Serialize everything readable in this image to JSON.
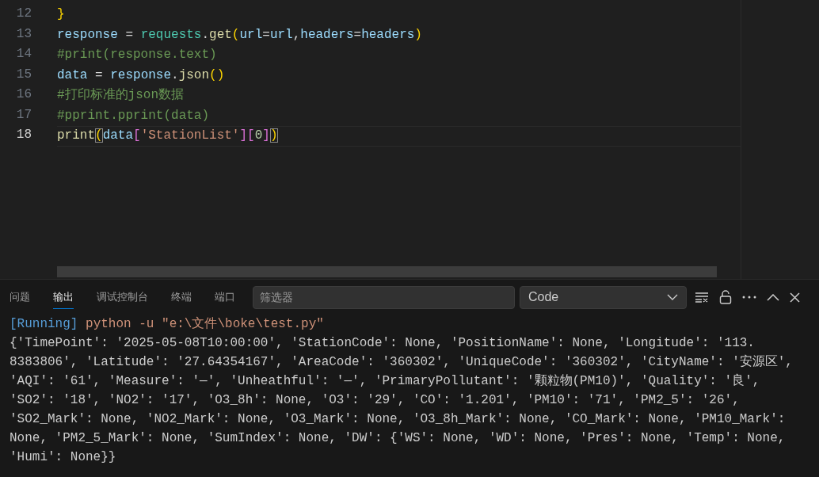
{
  "editor": {
    "lines": [
      {
        "number": "12",
        "current": false,
        "tokens": [
          {
            "kind": "bracket",
            "text": "}"
          }
        ]
      },
      {
        "number": "13",
        "current": false,
        "tokens": [
          {
            "kind": "variable",
            "text": "response"
          },
          {
            "kind": "operator",
            "text": " = "
          },
          {
            "kind": "module",
            "text": "requests"
          },
          {
            "kind": "operator",
            "text": "."
          },
          {
            "kind": "function",
            "text": "get"
          },
          {
            "kind": "bracket",
            "text": "("
          },
          {
            "kind": "variable",
            "text": "url"
          },
          {
            "kind": "operator",
            "text": "="
          },
          {
            "kind": "variable",
            "text": "url"
          },
          {
            "kind": "operator",
            "text": ","
          },
          {
            "kind": "variable",
            "text": "headers"
          },
          {
            "kind": "operator",
            "text": "="
          },
          {
            "kind": "variable",
            "text": "headers"
          },
          {
            "kind": "bracket",
            "text": ")"
          }
        ]
      },
      {
        "number": "14",
        "current": false,
        "tokens": [
          {
            "kind": "comment",
            "text": "#print(response.text)"
          }
        ]
      },
      {
        "number": "15",
        "current": false,
        "tokens": [
          {
            "kind": "variable",
            "text": "data"
          },
          {
            "kind": "operator",
            "text": " = "
          },
          {
            "kind": "variable",
            "text": "response"
          },
          {
            "kind": "operator",
            "text": "."
          },
          {
            "kind": "function",
            "text": "json"
          },
          {
            "kind": "bracket",
            "text": "()"
          }
        ]
      },
      {
        "number": "16",
        "current": false,
        "tokens": [
          {
            "kind": "comment",
            "text": "#打印标准的json数据"
          }
        ]
      },
      {
        "number": "17",
        "current": false,
        "tokens": [
          {
            "kind": "comment",
            "text": "#pprint.pprint(data)"
          }
        ]
      },
      {
        "number": "18",
        "current": true,
        "tokens": [
          {
            "kind": "function",
            "text": "print"
          },
          {
            "kind": "bracket",
            "text": "(",
            "matched": true
          },
          {
            "kind": "variable",
            "text": "data"
          },
          {
            "kind": "bracket2",
            "text": "["
          },
          {
            "kind": "string",
            "text": "'StationList'"
          },
          {
            "kind": "bracket2",
            "text": "]["
          },
          {
            "kind": "number",
            "text": "0"
          },
          {
            "kind": "bracket2",
            "text": "]"
          },
          {
            "kind": "bracket",
            "text": ")",
            "matched": true
          }
        ]
      }
    ]
  },
  "panel": {
    "tabs": [
      {
        "label": "问题",
        "selected": false
      },
      {
        "label": "输出",
        "selected": true
      },
      {
        "label": "调试控制台",
        "selected": false
      },
      {
        "label": "终端",
        "selected": false
      },
      {
        "label": "端口",
        "selected": false
      }
    ],
    "filter": {
      "placeholder": "筛选器"
    },
    "channel": {
      "value": "Code"
    },
    "output": {
      "status": "[Running]",
      "command": "python -u \"e:\\文件\\boke\\test.py\"",
      "lines": [
        "{'TimePoint': '2025-05-08T10:00:00', 'StationCode': None, 'PositionName': None, 'Longitude': '113.",
        "8383806', 'Latitude': '27.64354167', 'AreaCode': '360302', 'UniqueCode': '360302', 'CityName': '安源区',",
        "'AQI': '61', 'Measure': '—', 'Unheathful': '—', 'PrimaryPollutant': '颗粒物(PM10)', 'Quality': '良',",
        "'SO2': '18', 'NO2': '17', 'O3_8h': None, 'O3': '29', 'CO': '1.201', 'PM10': '71', 'PM2_5': '26',",
        "'SO2_Mark': None, 'NO2_Mark': None, 'O3_Mark': None, 'O3_8h_Mark': None, 'CO_Mark': None, 'PM10_Mark':",
        "None, 'PM2_5_Mark': None, 'SumIndex': None, 'DW': {'WS': None, 'WD': None, 'Pres': None, 'Temp': None,",
        "'Humi': None}}"
      ]
    }
  }
}
